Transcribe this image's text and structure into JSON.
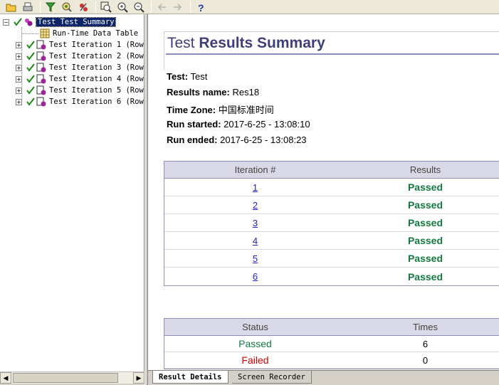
{
  "toolbar": {
    "buttons": [
      {
        "name": "open-icon"
      },
      {
        "name": "print-icon"
      },
      {
        "name": "filter-icon"
      },
      {
        "name": "find-icon"
      },
      {
        "name": "refresh-icon"
      },
      {
        "name": "zoom-fit-icon"
      },
      {
        "name": "zoom-in-icon"
      },
      {
        "name": "zoom-out-icon"
      },
      {
        "name": "back-arrow-icon"
      },
      {
        "name": "forward-arrow-icon"
      },
      {
        "name": "help-icon"
      }
    ]
  },
  "tree": {
    "root": "Test Test Summary",
    "data_table": "Run-Time Data Table",
    "iterations": [
      "Test Iteration 1 (Row",
      "Test Iteration 2 (Row",
      "Test Iteration 3 (Row",
      "Test Iteration 4 (Row",
      "Test Iteration 5 (Row",
      "Test Iteration 6 (Row"
    ]
  },
  "summary": {
    "title_light": "Test ",
    "title_bold": "Results Summary",
    "test_label": "Test:",
    "test_value": " Test",
    "results_label": "Results name:",
    "results_value": " Res18",
    "tz_label": "Time Zone:",
    "tz_value": " 中国标准时间",
    "started_label": "Run started:",
    "started_value": " 2017-6-25 - 13:08:10",
    "ended_label": "Run ended:",
    "ended_value": " 2017-6-25 - 13:08:23"
  },
  "iterations_table": {
    "headers": [
      "Iteration #",
      "Results"
    ],
    "rows": [
      {
        "iteration": "1",
        "result": "Passed"
      },
      {
        "iteration": "2",
        "result": "Passed"
      },
      {
        "iteration": "3",
        "result": "Passed"
      },
      {
        "iteration": "4",
        "result": "Passed"
      },
      {
        "iteration": "5",
        "result": "Passed"
      },
      {
        "iteration": "6",
        "result": "Passed"
      }
    ]
  },
  "status_table": {
    "headers": [
      "Status",
      "Times"
    ],
    "rows": [
      {
        "status": "Passed",
        "times": "6"
      },
      {
        "status": "Failed",
        "times": "0"
      }
    ]
  },
  "tabs": {
    "active": "Result Details",
    "inactive": "Screen Recorder"
  }
}
